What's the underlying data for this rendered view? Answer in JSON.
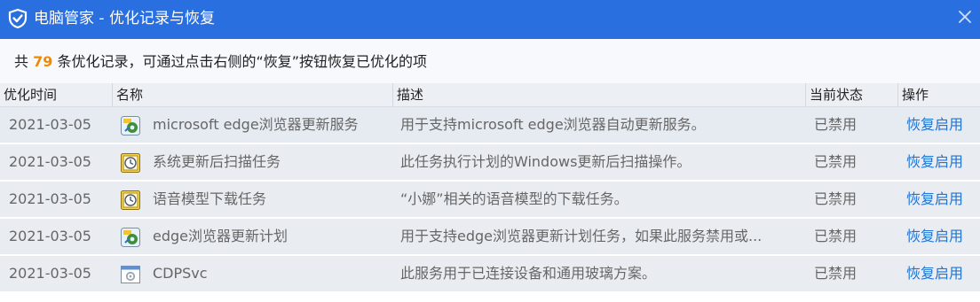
{
  "window": {
    "title": "电脑管家 - 优化记录与恢复",
    "logo_icon": "shield-logo-icon",
    "close_icon": "close-icon"
  },
  "summary": {
    "prefix": "共 ",
    "count": "79",
    "suffix": " 条优化记录，可通过点击右侧的“恢复”按钮恢复已优化的项"
  },
  "columns": {
    "time": "优化时间",
    "name": "名称",
    "desc": "描述",
    "state": "当前状态",
    "action": "操作"
  },
  "rows": [
    {
      "date": "2021-03-05",
      "icon": "service-gear-icon",
      "name": "microsoft edge浏览器更新服务",
      "desc": "用于支持microsoft edge浏览器自动更新服务。",
      "state": "已禁用",
      "action": "恢复启用"
    },
    {
      "date": "2021-03-05",
      "icon": "scheduled-task-clock-icon",
      "name": "系统更新后扫描任务",
      "desc": "此任务执行计划的Windows更新后扫描操作。",
      "state": "已禁用",
      "action": "恢复启用"
    },
    {
      "date": "2021-03-05",
      "icon": "scheduled-task-clock-icon",
      "name": "语音模型下载任务",
      "desc": "“小娜”相关的语音模型的下载任务。",
      "state": "已禁用",
      "action": "恢复启用"
    },
    {
      "date": "2021-03-05",
      "icon": "service-gear-icon",
      "name": "edge浏览器更新计划",
      "desc": "用于支持edge浏览器更新计划任务，如果此服务禁用或...",
      "state": "已禁用",
      "action": "恢复启用"
    },
    {
      "date": "2021-03-05",
      "icon": "window-service-icon",
      "name": "CDPSvc",
      "desc": "此服务用于已连接设备和通用玻璃方案。",
      "state": "已禁用",
      "action": "恢复启用"
    }
  ]
}
